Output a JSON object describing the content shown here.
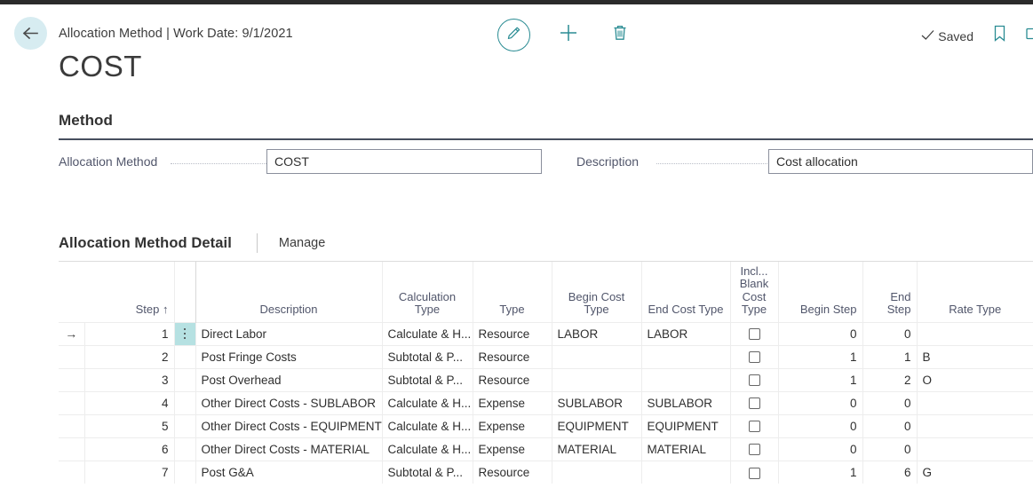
{
  "header": {
    "back_label": "Back",
    "breadcrumb": "Allocation Method | Work Date: 9/1/2021",
    "title": "COST",
    "edit_label": "Edit",
    "new_label": "New",
    "delete_label": "Delete",
    "saved_label": "Saved",
    "bookmark_label": "Bookmark",
    "open_label": "Open in new window"
  },
  "method_section": {
    "title": "Method",
    "allocation_method_label": "Allocation Method",
    "allocation_method_value": "COST",
    "description_label": "Description",
    "description_value": "Cost allocation"
  },
  "detail_section": {
    "title": "Allocation Method Detail",
    "manage_label": "Manage"
  },
  "grid": {
    "columns": [
      {
        "key": "indicator",
        "label": ""
      },
      {
        "key": "step",
        "label": "Step ↑"
      },
      {
        "key": "menu",
        "label": ""
      },
      {
        "key": "description",
        "label": "Description"
      },
      {
        "key": "calculation_type",
        "label": "Calculation Type"
      },
      {
        "key": "type",
        "label": "Type"
      },
      {
        "key": "begin_cost_type",
        "label": "Begin Cost Type"
      },
      {
        "key": "end_cost_type",
        "label": "End Cost Type"
      },
      {
        "key": "incl_blank_cost_type",
        "label": "Incl... Blank Cost Type"
      },
      {
        "key": "begin_step",
        "label": "Begin Step"
      },
      {
        "key": "end_step",
        "label": "End Step"
      },
      {
        "key": "rate_type",
        "label": "Rate Type"
      }
    ],
    "rows": [
      {
        "selected": true,
        "step": "1",
        "description": "Direct Labor",
        "calculation_type": "Calculate & H...",
        "type": "Resource",
        "begin_cost_type": "LABOR",
        "end_cost_type": "LABOR",
        "incl_blank_cost_type": false,
        "begin_step": "0",
        "end_step": "0",
        "rate_type": ""
      },
      {
        "selected": false,
        "step": "2",
        "description": "Post Fringe Costs",
        "calculation_type": "Subtotal & P...",
        "type": "Resource",
        "begin_cost_type": "",
        "end_cost_type": "",
        "incl_blank_cost_type": false,
        "begin_step": "1",
        "end_step": "1",
        "rate_type": "B"
      },
      {
        "selected": false,
        "step": "3",
        "description": "Post Overhead",
        "calculation_type": "Subtotal & P...",
        "type": "Resource",
        "begin_cost_type": "",
        "end_cost_type": "",
        "incl_blank_cost_type": false,
        "begin_step": "1",
        "end_step": "2",
        "rate_type": "O"
      },
      {
        "selected": false,
        "step": "4",
        "description": "Other Direct Costs - SUBLABOR",
        "calculation_type": "Calculate & H...",
        "type": "Expense",
        "begin_cost_type": "SUBLABOR",
        "end_cost_type": "SUBLABOR",
        "incl_blank_cost_type": false,
        "begin_step": "0",
        "end_step": "0",
        "rate_type": ""
      },
      {
        "selected": false,
        "step": "5",
        "description": "Other Direct Costs - EQUIPMENT",
        "calculation_type": "Calculate & H...",
        "type": "Expense",
        "begin_cost_type": "EQUIPMENT",
        "end_cost_type": "EQUIPMENT",
        "incl_blank_cost_type": false,
        "begin_step": "0",
        "end_step": "0",
        "rate_type": ""
      },
      {
        "selected": false,
        "step": "6",
        "description": "Other Direct Costs - MATERIAL",
        "calculation_type": "Calculate & H...",
        "type": "Expense",
        "begin_cost_type": "MATERIAL",
        "end_cost_type": "MATERIAL",
        "incl_blank_cost_type": false,
        "begin_step": "0",
        "end_step": "0",
        "rate_type": ""
      },
      {
        "selected": false,
        "step": "7",
        "description": "Post G&A",
        "calculation_type": "Subtotal & P...",
        "type": "Resource",
        "begin_cost_type": "",
        "end_cost_type": "",
        "incl_blank_cost_type": false,
        "begin_step": "1",
        "end_step": "6",
        "rate_type": "G"
      }
    ]
  },
  "colors": {
    "accent_teal": "#2a8c93",
    "selection_teal": "#b6e1e2",
    "back_circle": "#d7ecf1",
    "rule_dark": "#474f5e"
  }
}
